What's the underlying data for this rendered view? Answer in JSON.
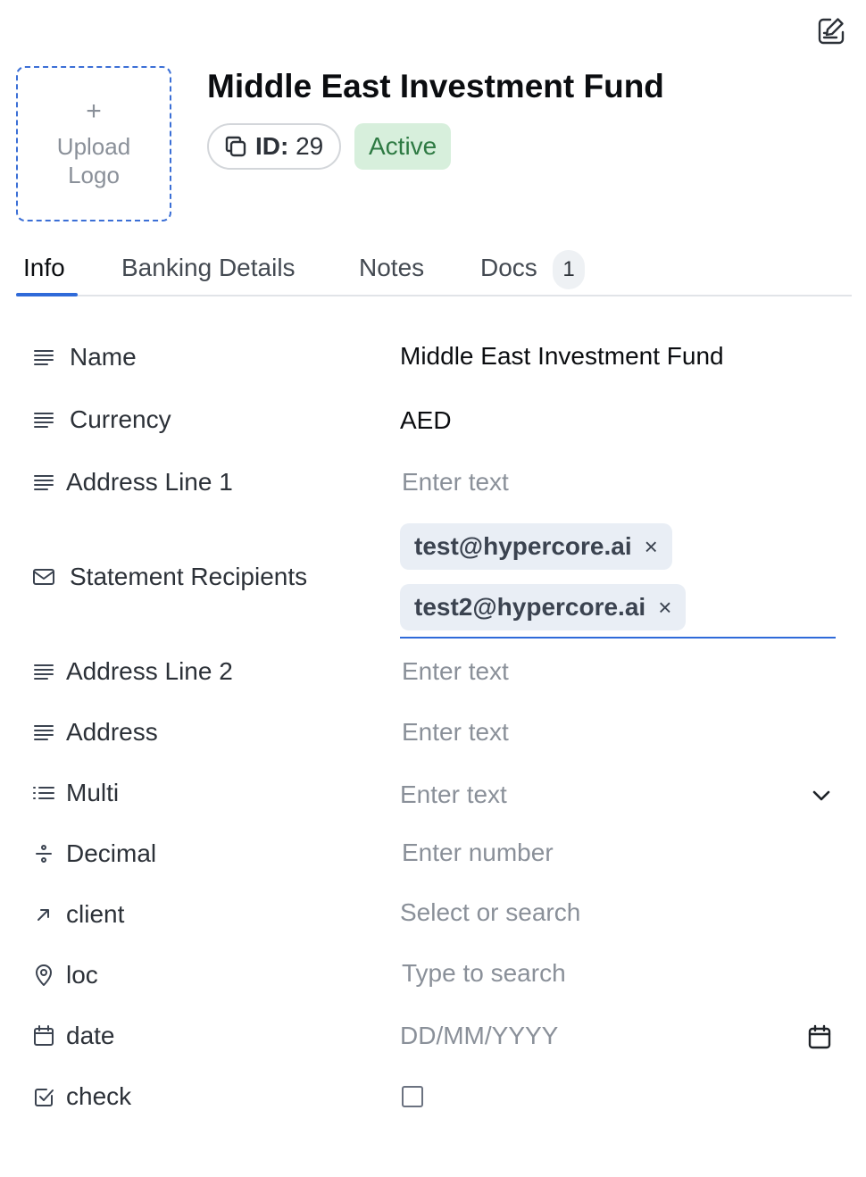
{
  "header": {
    "title": "Middle East Investment Fund",
    "upload_plus": "+",
    "upload_label": "Upload Logo",
    "id_label": "ID:",
    "id_value": "29",
    "status": "Active"
  },
  "tabs": {
    "info": "Info",
    "banking": "Banking Details",
    "notes": "Notes",
    "docs": "Docs",
    "docs_count": "1"
  },
  "fields": {
    "name": {
      "label": "Name",
      "value": "Middle East Investment Fund"
    },
    "currency": {
      "label": "Currency",
      "value": "AED"
    },
    "address1": {
      "label": "Address Line 1",
      "placeholder": "Enter text"
    },
    "recipients": {
      "label": "Statement Recipients",
      "chips": [
        "test@hypercore.ai",
        "test2@hypercore.ai"
      ],
      "remove": "×"
    },
    "address2": {
      "label": "Address Line 2",
      "placeholder": "Enter text"
    },
    "address": {
      "label": "Address",
      "placeholder": "Enter text"
    },
    "multi": {
      "label": "Multi",
      "placeholder": "Enter text"
    },
    "decimal": {
      "label": "Decimal",
      "placeholder": "Enter number"
    },
    "client": {
      "label": "client",
      "placeholder": "Select or search"
    },
    "loc": {
      "label": "loc",
      "placeholder": "Type to search"
    },
    "date": {
      "label": "date",
      "placeholder": "DD/MM/YYYY"
    },
    "check": {
      "label": "check",
      "checked": false
    }
  },
  "colors": {
    "accent": "#2f6ad9",
    "active_bg": "#d7efdc",
    "active_text": "#2e7a43",
    "chip_bg": "#e9eef5"
  }
}
